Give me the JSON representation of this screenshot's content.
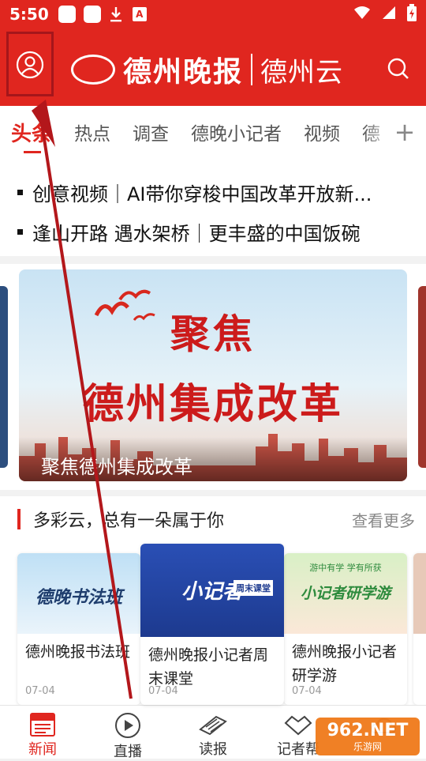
{
  "status_bar": {
    "time": "5:50",
    "icons": [
      "app-icon",
      "app-icon",
      "download-icon",
      "a-icon"
    ],
    "right_icons": [
      "wifi-icon",
      "signal-icon",
      "battery-icon"
    ]
  },
  "header": {
    "brand": "德州晚报",
    "sub_brand": "德州云",
    "accent_color": "#e0261f",
    "user_icon": "user-icon",
    "search_icon": "search-icon"
  },
  "tabs": {
    "items": [
      "头条",
      "热点",
      "调查",
      "德晚小记者",
      "视频",
      "德"
    ],
    "active_index": 0,
    "add_label": "+"
  },
  "headlines": [
    "创意视频｜AI带你穿梭中国改革开放新...",
    "逢山开路 遇水架桥｜更丰盛的中国饭碗"
  ],
  "banner": {
    "line1": "聚焦",
    "line2": "德州集成改革",
    "caption": "聚焦德州集成改革"
  },
  "section": {
    "title": "多彩云，总有一朵属于你",
    "more": "查看更多",
    "cards": [
      {
        "thumb_text": "德晚书法班",
        "title": "德州晚报书法班",
        "date": "07-04"
      },
      {
        "thumb_text": "小记者",
        "thumb_badge": "周末课堂",
        "title": "德州晚报小记者周末课堂",
        "date": "07-04"
      },
      {
        "thumb_top": "游中有学 学有所获",
        "thumb_text": "小记者研学游",
        "title": "德州晚报小记者研学游",
        "date": "07-04"
      }
    ]
  },
  "bottom_nav": {
    "items": [
      {
        "label": "新闻",
        "icon": "news-icon"
      },
      {
        "label": "直播",
        "icon": "live-play-icon"
      },
      {
        "label": "读报",
        "icon": "newspaper-icon"
      },
      {
        "label": "记者帮",
        "icon": "handshake-icon"
      },
      {
        "label": "",
        "icon": "cloud-icon"
      }
    ],
    "active_index": 0
  },
  "watermark": {
    "main": "962.NET",
    "sub": "乐游网"
  }
}
